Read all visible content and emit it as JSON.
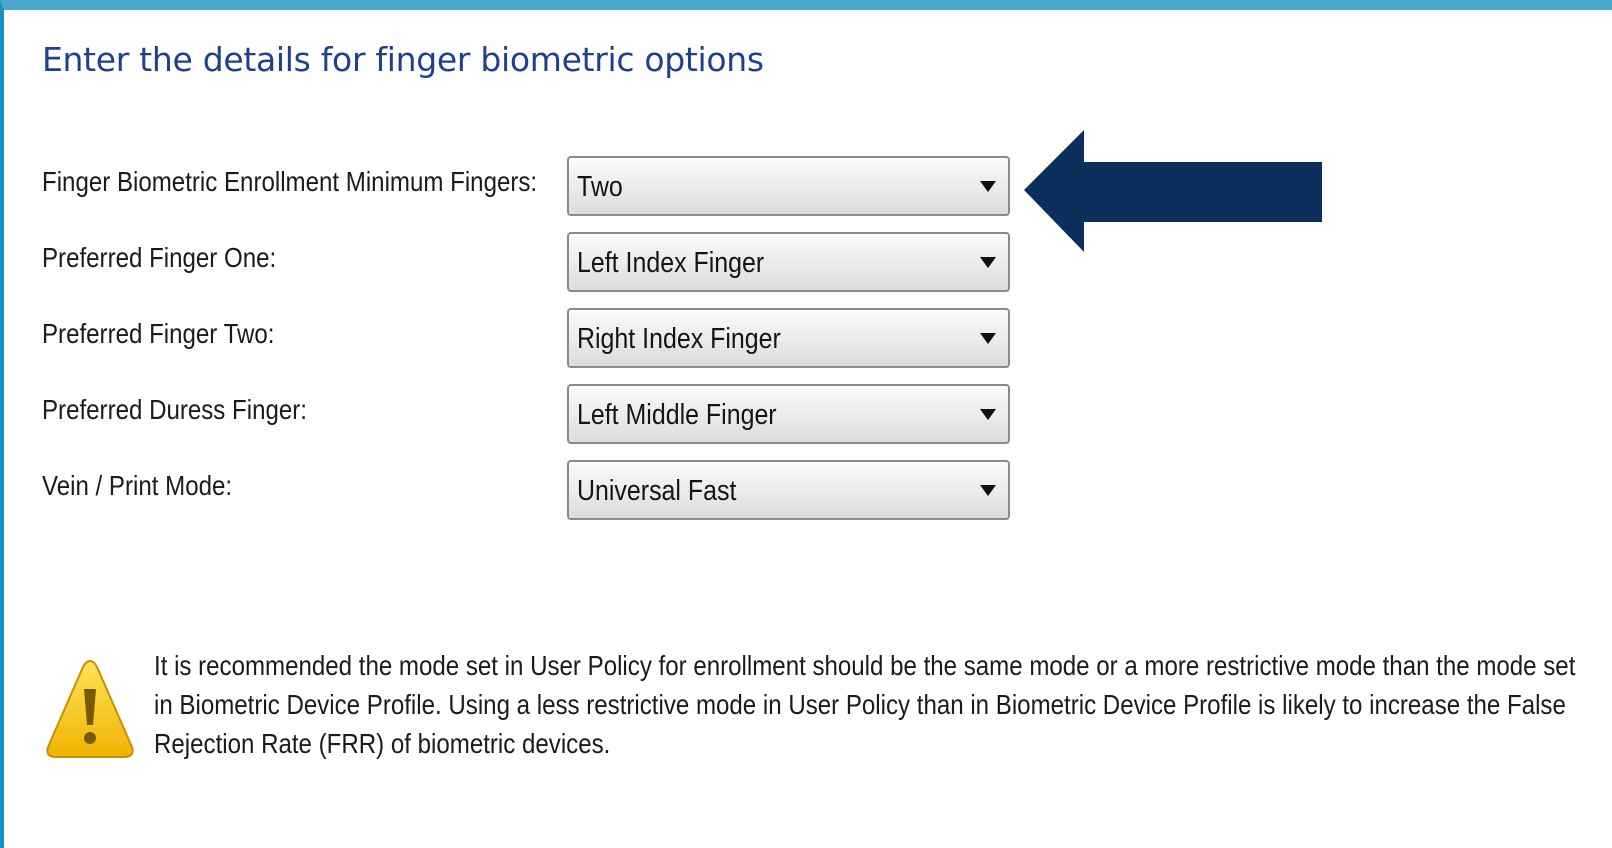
{
  "heading": "Enter the details for finger biometric options",
  "fields": [
    {
      "label": "Finger Biometric Enrollment Minimum Fingers:",
      "value": "Two"
    },
    {
      "label": "Preferred Finger One:",
      "value": "Left Index Finger"
    },
    {
      "label": "Preferred Finger Two:",
      "value": "Right Index Finger"
    },
    {
      "label": "Preferred Duress Finger:",
      "value": "Left Middle Finger"
    },
    {
      "label": "Vein / Print Mode:",
      "value": "Universal Fast"
    }
  ],
  "warning": {
    "icon": "warning-triangle-icon",
    "text": "It is recommended the mode set in User Policy for enrollment should be the same mode or a more restrictive mode than the mode set in Biometric Device Profile.  Using a less restrictive mode in User Policy than in Biometric Device Profile is likely to increase the False Rejection Rate (FRR) of biometric devices."
  },
  "colors": {
    "heading": "#1f3f8f",
    "top_border": "#4aa7cf",
    "callout_arrow": "#0b2f5a",
    "warning_fill": "#f5c518"
  }
}
